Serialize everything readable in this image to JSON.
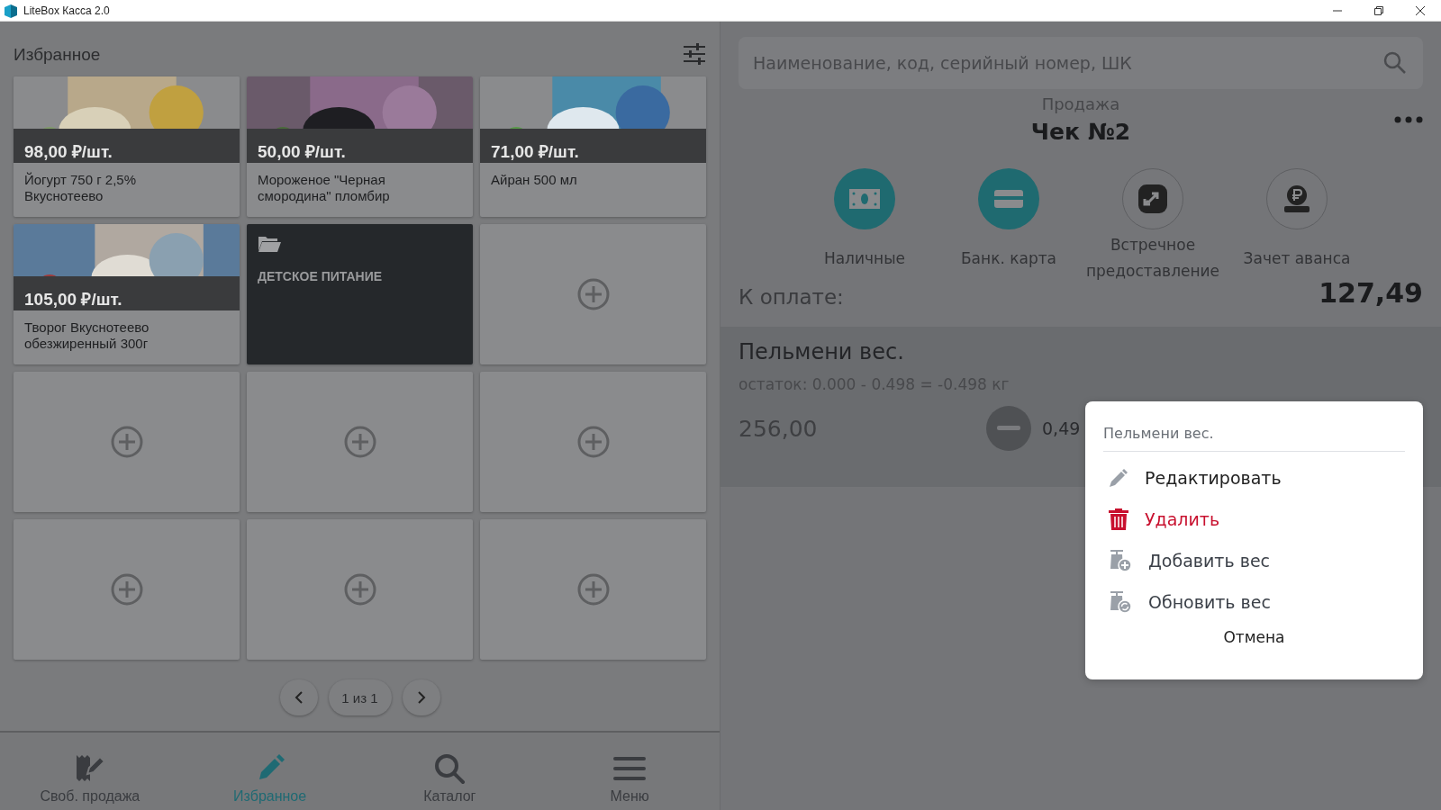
{
  "window": {
    "title": "LiteBox Касса 2.0"
  },
  "favorites": {
    "title": "Избранное",
    "tiles": [
      {
        "kind": "product",
        "price": "98,00 ₽/шт.",
        "name": "Йогурт 750 г 2,5% Вкуснотеево"
      },
      {
        "kind": "product",
        "price": "50,00 ₽/шт.",
        "name": "Мороженое \"Черная смородина\" пломбир"
      },
      {
        "kind": "product",
        "price": "71,00 ₽/шт.",
        "name": "Айран 500 мл"
      },
      {
        "kind": "product",
        "price": "105,00 ₽/шт.",
        "name": "Творог Вкуснотеево обезжиренный 300г"
      },
      {
        "kind": "folder",
        "name": "ДЕТСКОЕ ПИТАНИЕ"
      },
      {
        "kind": "empty"
      },
      {
        "kind": "empty"
      },
      {
        "kind": "empty"
      },
      {
        "kind": "empty"
      },
      {
        "kind": "empty"
      },
      {
        "kind": "empty"
      },
      {
        "kind": "empty"
      }
    ],
    "pager": "1 из 1"
  },
  "nav": [
    {
      "label": "Своб. продажа",
      "kind": "free-sale",
      "selected": false
    },
    {
      "label": "Избранное",
      "kind": "favorites",
      "selected": true
    },
    {
      "label": "Каталог",
      "kind": "catalog",
      "selected": false
    },
    {
      "label": "Меню",
      "kind": "menu",
      "selected": false
    }
  ],
  "search": {
    "placeholder": "Наименование, код, серийный номер, ШК"
  },
  "receipt": {
    "mode": "Продажа",
    "title": "Чек №2",
    "payments": [
      {
        "label": "Наличные",
        "kind": "cash",
        "highlighted": true
      },
      {
        "label": "Банк. карта",
        "kind": "card",
        "highlighted": true
      },
      {
        "label": "Встречное предоставление",
        "kind": "exchange",
        "highlighted": false
      },
      {
        "label": "Зачет аванса",
        "kind": "advance",
        "highlighted": false
      }
    ],
    "due_label": "К оплате:",
    "due_amount": "127,49",
    "item": {
      "name": "Пельмени вес.",
      "remainder": "остаток: 0.000 - 0.498 = -0.498 кг",
      "price": "256,00",
      "quantity": "0,49"
    }
  },
  "context_menu": {
    "title": "Пельмени вес.",
    "items": [
      {
        "label": "Редактировать",
        "kind": "edit"
      },
      {
        "label": "Удалить",
        "kind": "delete"
      },
      {
        "label": "Добавить вес",
        "kind": "add-weight"
      },
      {
        "label": "Обновить вес",
        "kind": "update-weight"
      }
    ],
    "cancel": "Отмена"
  }
}
